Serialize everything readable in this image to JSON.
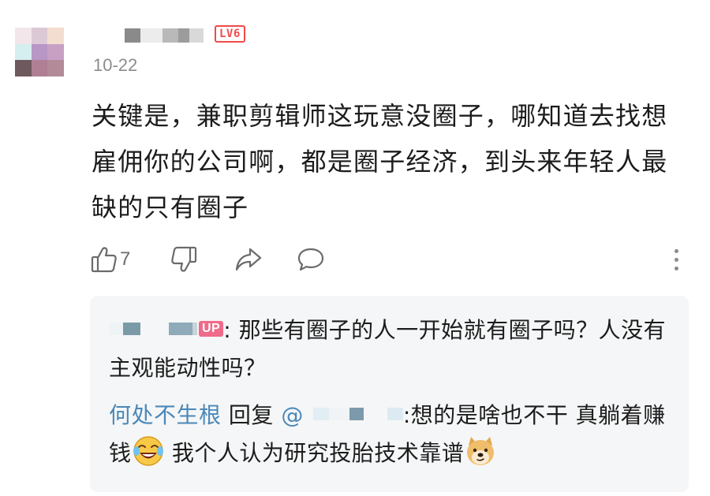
{
  "comment": {
    "avatar_icon": "blurred-avatar",
    "level_badge": "LV6",
    "date": "10-22",
    "text": "关键是，兼职剪辑师这玩意没圈子，哪知道去找想雇佣你的公司啊，都是圈子经济，到头来年轻人最缺的只有圈子",
    "like_count": "7",
    "icons": {
      "like": "thumbs-up-icon",
      "dislike": "thumbs-down-icon",
      "share": "share-icon",
      "reply": "comment-icon",
      "more": "more-vertical-icon"
    }
  },
  "replies": [
    {
      "badge": "UP",
      "separator": ":",
      "text": " 那些有圈子的人一开始就有圈子吗？人没有主观能动性吗？"
    },
    {
      "user": "何处不生根",
      "reply_word": " 回复 ",
      "mention_at": "@",
      "separator": ":",
      "text_part1": "想的是啥也不干 真躺着赚钱",
      "text_part2": " 我个人认为研究投胎技术靠谱",
      "emojis": [
        "laughing-tears-emoji-icon",
        "doge-emoji-icon"
      ]
    }
  ],
  "colors": {
    "level_badge": "#f04a4a",
    "up_badge": "#f06a8a",
    "link_blue": "#4a88b8",
    "reply_bg": "#f5f6f7",
    "meta_gray": "#8c8c8c"
  }
}
